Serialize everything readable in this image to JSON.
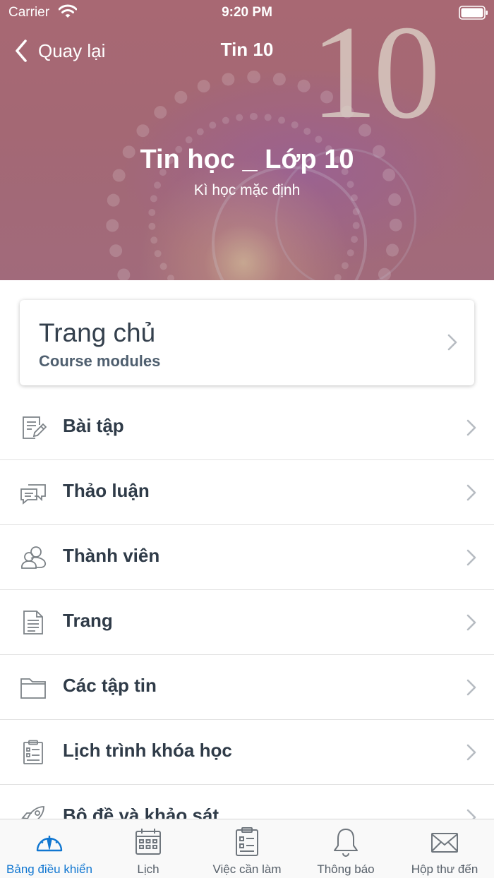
{
  "status_bar": {
    "carrier": "Carrier",
    "time": "9:20 PM"
  },
  "nav": {
    "back_label": "Quay lại",
    "title": "Tin 10"
  },
  "hero": {
    "background_number": "10",
    "course_title": "Tin học _ Lớp 10",
    "course_subtitle": "Kì học mặc định"
  },
  "home_card": {
    "title": "Trang chủ",
    "subtitle": "Course modules"
  },
  "menu": [
    {
      "label": "Bài tập",
      "icon": "assignment-icon"
    },
    {
      "label": "Thảo luận",
      "icon": "discussion-icon"
    },
    {
      "label": "Thành viên",
      "icon": "members-icon"
    },
    {
      "label": "Trang",
      "icon": "page-icon"
    },
    {
      "label": "Các tập tin",
      "icon": "folder-icon"
    },
    {
      "label": "Lịch trình khóa học",
      "icon": "syllabus-icon"
    },
    {
      "label": "Bộ đề và khảo sát",
      "icon": "rocket-icon"
    }
  ],
  "tabs": [
    {
      "label": "Bảng điều khiển",
      "icon": "dashboard-icon",
      "active": true
    },
    {
      "label": "Lịch",
      "icon": "calendar-icon",
      "active": false
    },
    {
      "label": "Việc cần làm",
      "icon": "todo-icon",
      "active": false
    },
    {
      "label": "Thông báo",
      "icon": "bell-icon",
      "active": false
    },
    {
      "label": "Hộp thư đến",
      "icon": "inbox-icon",
      "active": false
    }
  ],
  "colors": {
    "accent": "#1177d1",
    "text": "#2f3b48",
    "icon_gray": "#7c8287",
    "hero_tint": "#ad6c77"
  }
}
